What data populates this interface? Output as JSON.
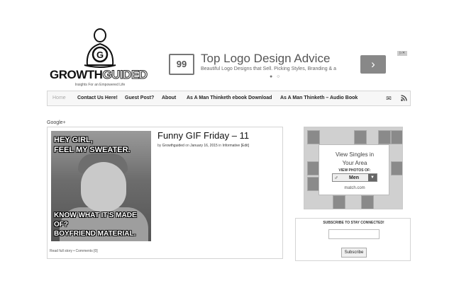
{
  "header": {
    "logo_part1": "GROWTH",
    "logo_part2": "GUIDED",
    "tagline": "Insights For an Empowered Life"
  },
  "ad": {
    "logo_text": "99",
    "title": "Top Logo Design Advice",
    "description": "Beautiful Logo Designs that Sell. Picking Styles, Branding & a Vision",
    "dots": "● ○",
    "arrow": "›",
    "badge": "▷✕"
  },
  "nav": {
    "items": [
      {
        "label": "Home"
      },
      {
        "label": "Contact Us Here!"
      },
      {
        "label": "Guest Post?"
      },
      {
        "label": "About"
      },
      {
        "label": "As A Man Thinketh ebook Download"
      },
      {
        "label": "As A Man Thinketh – Audio Book"
      }
    ],
    "mail_icon": "mail-icon",
    "rss_icon": "rss-icon"
  },
  "social": {
    "gplus_label": "Google+"
  },
  "post": {
    "title": "Funny GIF Friday – 11",
    "meta": {
      "by": "by ",
      "author": "Growthguided",
      "on": " on ",
      "date": "January 16, 2015",
      "in": " in ",
      "category": "Informative",
      "edit": " [Edit]"
    },
    "meme_top_line1": "HEY GIRL,",
    "meme_top_line2": "FEEL MY SWEATER.",
    "meme_bottom_line1": "KNOW WHAT IT'S MADE OF?",
    "meme_bottom_line2": "BOYFRIEND MATERIAL.",
    "read_more": "Read full story",
    "separator": "•",
    "comments": "Comments [0]"
  },
  "dating_ad": {
    "title_line1": "View Singles in",
    "title_line2": "Your Area",
    "view_label": "VIEW PHOTOS OF:",
    "select_value": "Men",
    "brand": "match.com"
  },
  "subscribe": {
    "title": "SUBSCRIBE TO STAY CONNECTED!",
    "button": "Subscribe"
  }
}
